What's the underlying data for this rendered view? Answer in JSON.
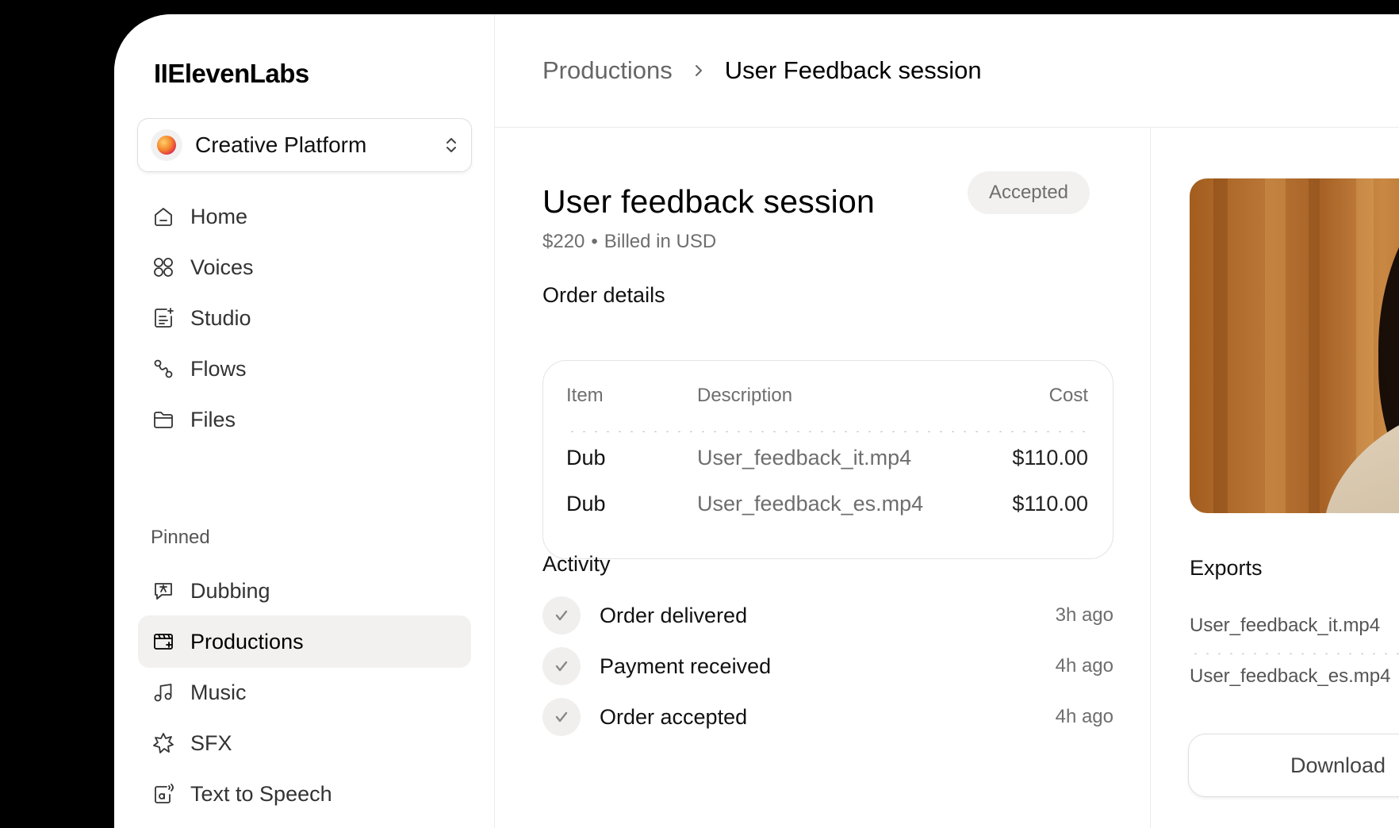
{
  "brand": {
    "name": "IIElevenLabs"
  },
  "workspace": {
    "name": "Creative Platform"
  },
  "sidebar": {
    "items": [
      {
        "label": "Home",
        "icon": "home-icon"
      },
      {
        "label": "Voices",
        "icon": "voices-icon"
      },
      {
        "label": "Studio",
        "icon": "studio-icon"
      },
      {
        "label": "Flows",
        "icon": "flows-icon"
      },
      {
        "label": "Files",
        "icon": "files-icon"
      }
    ],
    "pinned_label": "Pinned",
    "pinned": [
      {
        "label": "Dubbing",
        "icon": "dubbing-icon"
      },
      {
        "label": "Productions",
        "icon": "productions-icon",
        "active": true
      },
      {
        "label": "Music",
        "icon": "music-icon"
      },
      {
        "label": "SFX",
        "icon": "sfx-icon"
      },
      {
        "label": "Text to Speech",
        "icon": "text-to-speech-icon"
      }
    ]
  },
  "breadcrumb": {
    "root": "Productions",
    "current": "User Feedback session"
  },
  "order": {
    "title": "User feedback session",
    "price": "$220",
    "billing": "Billed in USD",
    "status": "Accepted"
  },
  "order_details": {
    "title": "Order details",
    "headers": {
      "item": "Item",
      "description": "Description",
      "cost": "Cost"
    },
    "rows": [
      {
        "item": "Dub",
        "description": "User_feedback_it.mp4",
        "cost": "$110.00"
      },
      {
        "item": "Dub",
        "description": "User_feedback_es.mp4",
        "cost": "$110.00"
      }
    ]
  },
  "activity": {
    "title": "Activity",
    "events": [
      {
        "label": "Order delivered",
        "time": "3h ago"
      },
      {
        "label": "Payment received",
        "time": "4h ago"
      },
      {
        "label": "Order accepted",
        "time": "4h ago"
      }
    ]
  },
  "exports": {
    "title": "Exports",
    "files": [
      "User_feedback_it.mp4",
      "User_feedback_es.mp4"
    ],
    "download_label": "Download"
  },
  "colors": {
    "active_nav_bg": "#f2f1ef",
    "pill_bg": "#f2f1ef",
    "muted_text": "#6e6e6e"
  }
}
